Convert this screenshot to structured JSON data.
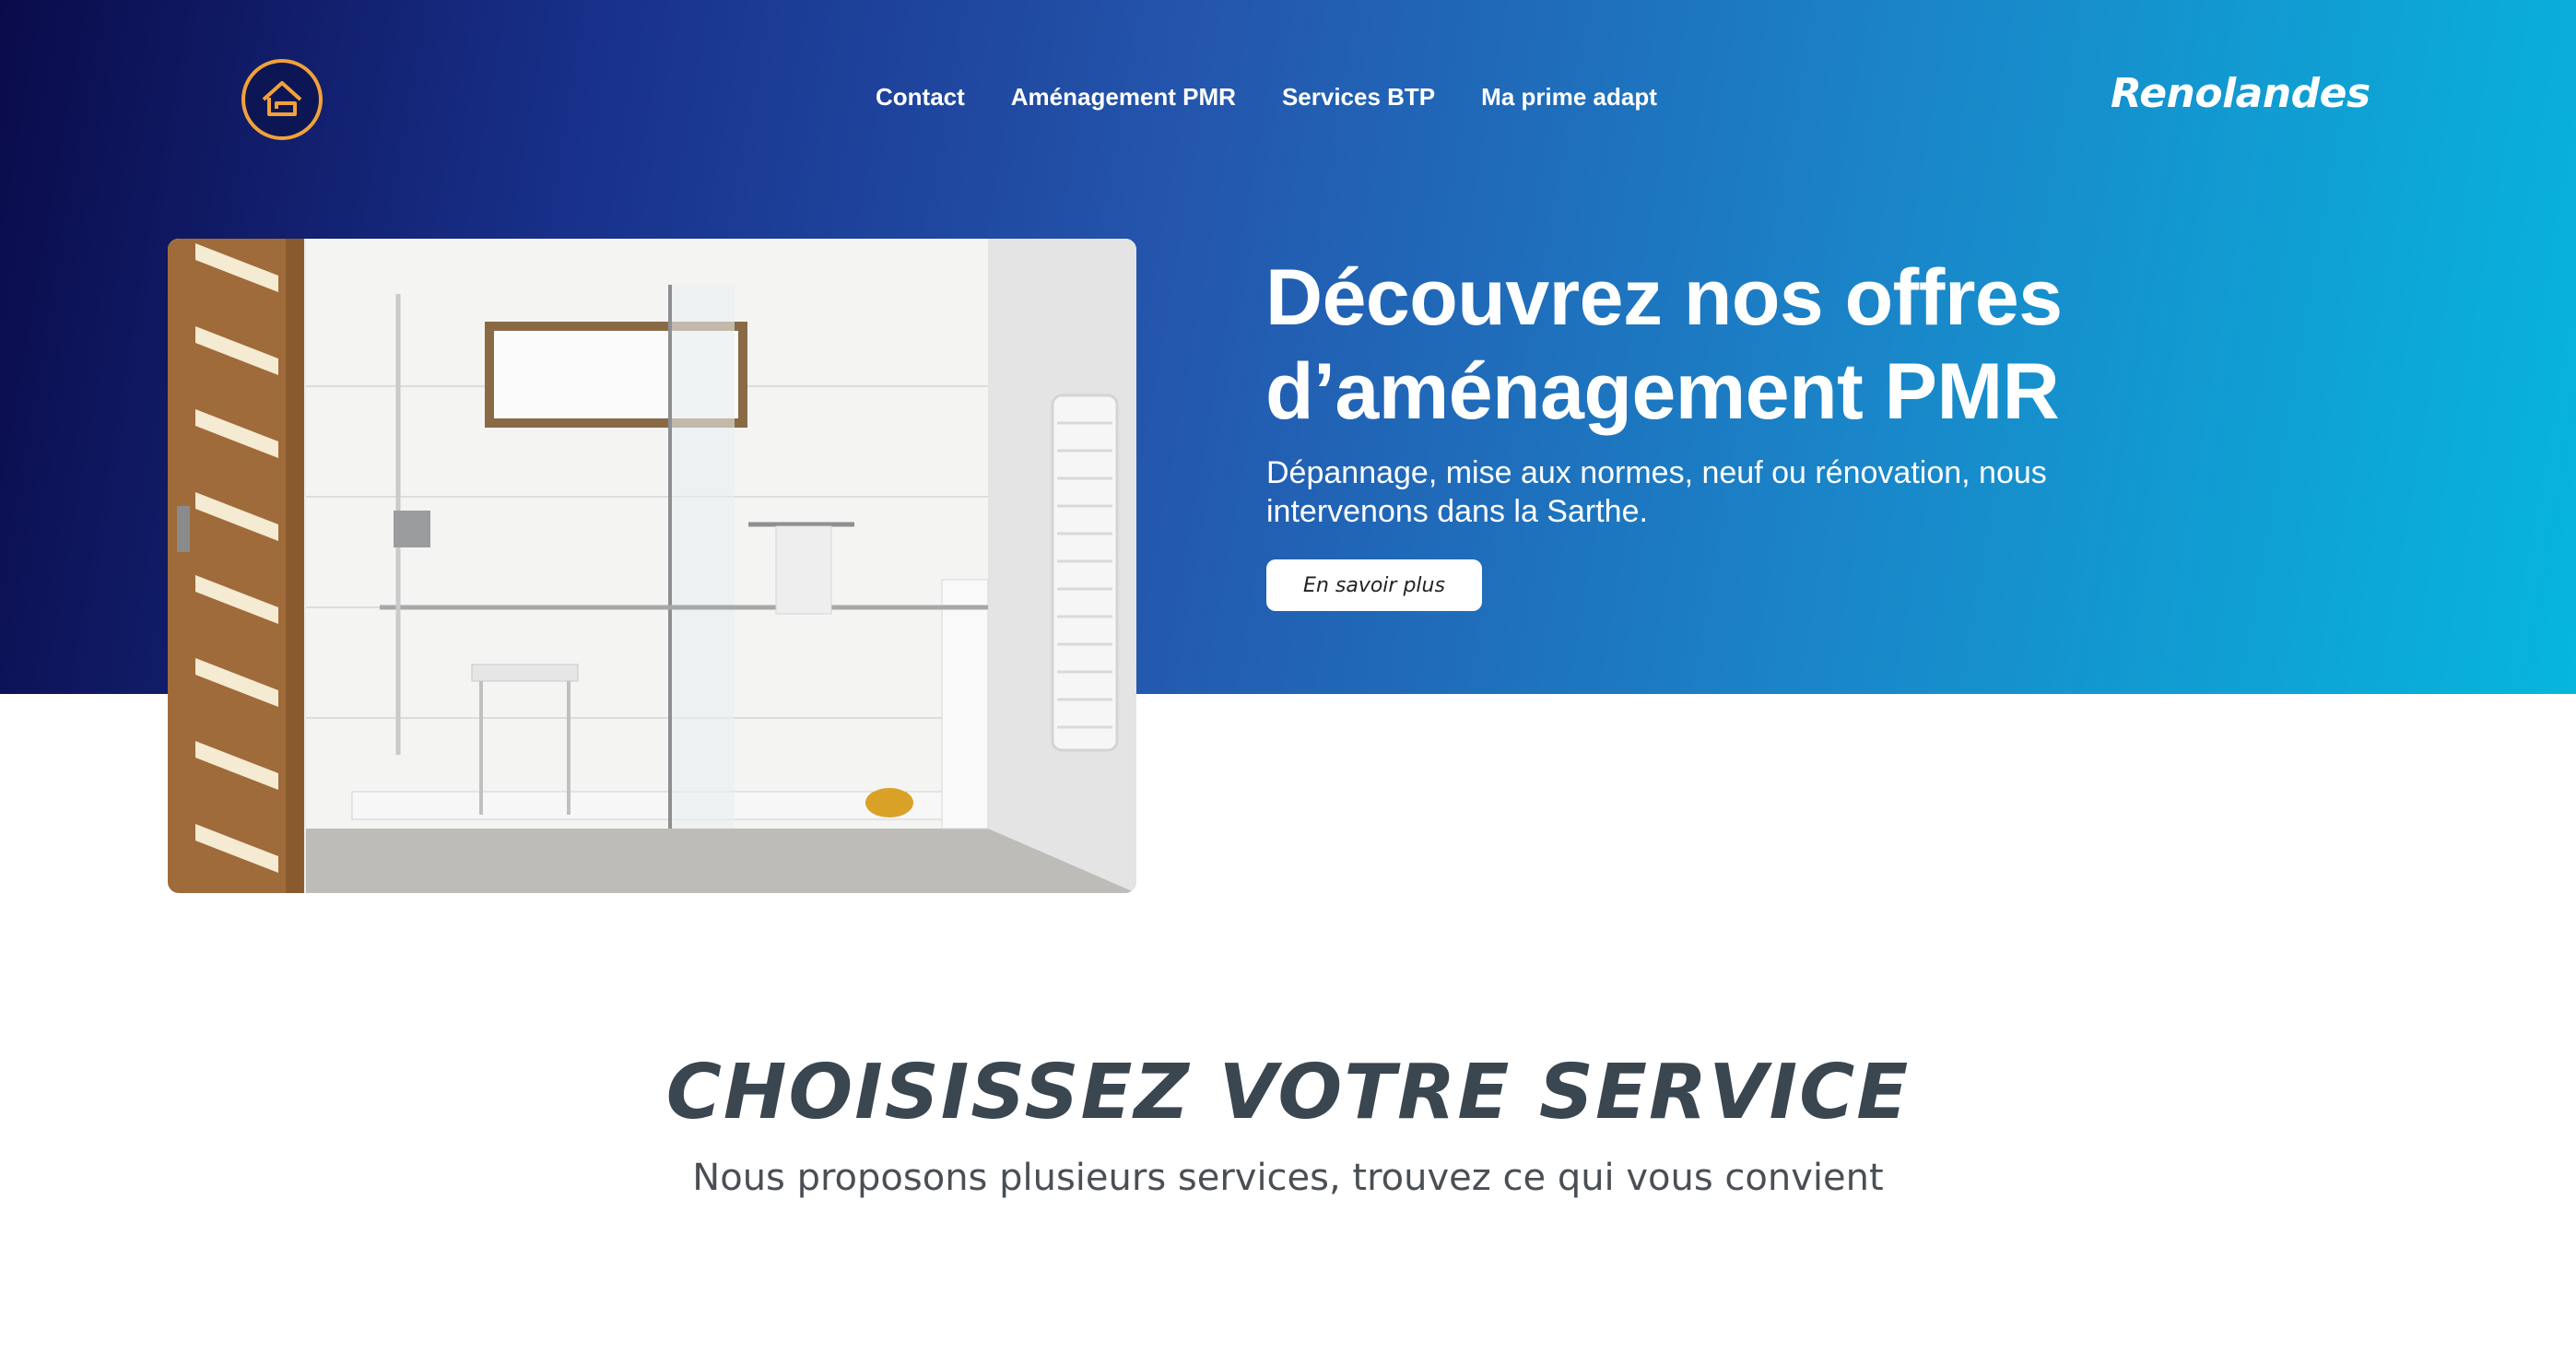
{
  "header": {
    "logo_icon": "house-logo-icon",
    "nav": [
      {
        "label": "Contact"
      },
      {
        "label": "Aménagement PMR"
      },
      {
        "label": "Services BTP"
      },
      {
        "label": "Ma prime adapt"
      }
    ],
    "brand": "Renolandes"
  },
  "hero": {
    "image_icon": "accessible-shower-photo",
    "headline_line1": "Découvrez nos offres",
    "headline_line2": "d’aménagement PMR",
    "subtext_line1": "Dépannage, mise aux normes, neuf ou rénovation, nous",
    "subtext_line2": "intervenons dans la Sarthe.",
    "cta_label": "En savoir plus"
  },
  "services": {
    "title": "CHOISISSEZ VOTRE SERVICE",
    "subtitle": "Nous proposons plusieurs services, trouvez ce qui vous convient"
  },
  "colors": {
    "gradient_start": "#0a0b4a",
    "gradient_end": "#06b6dc",
    "logo_accent": "#f2a13a",
    "title_color": "#3a4650"
  }
}
